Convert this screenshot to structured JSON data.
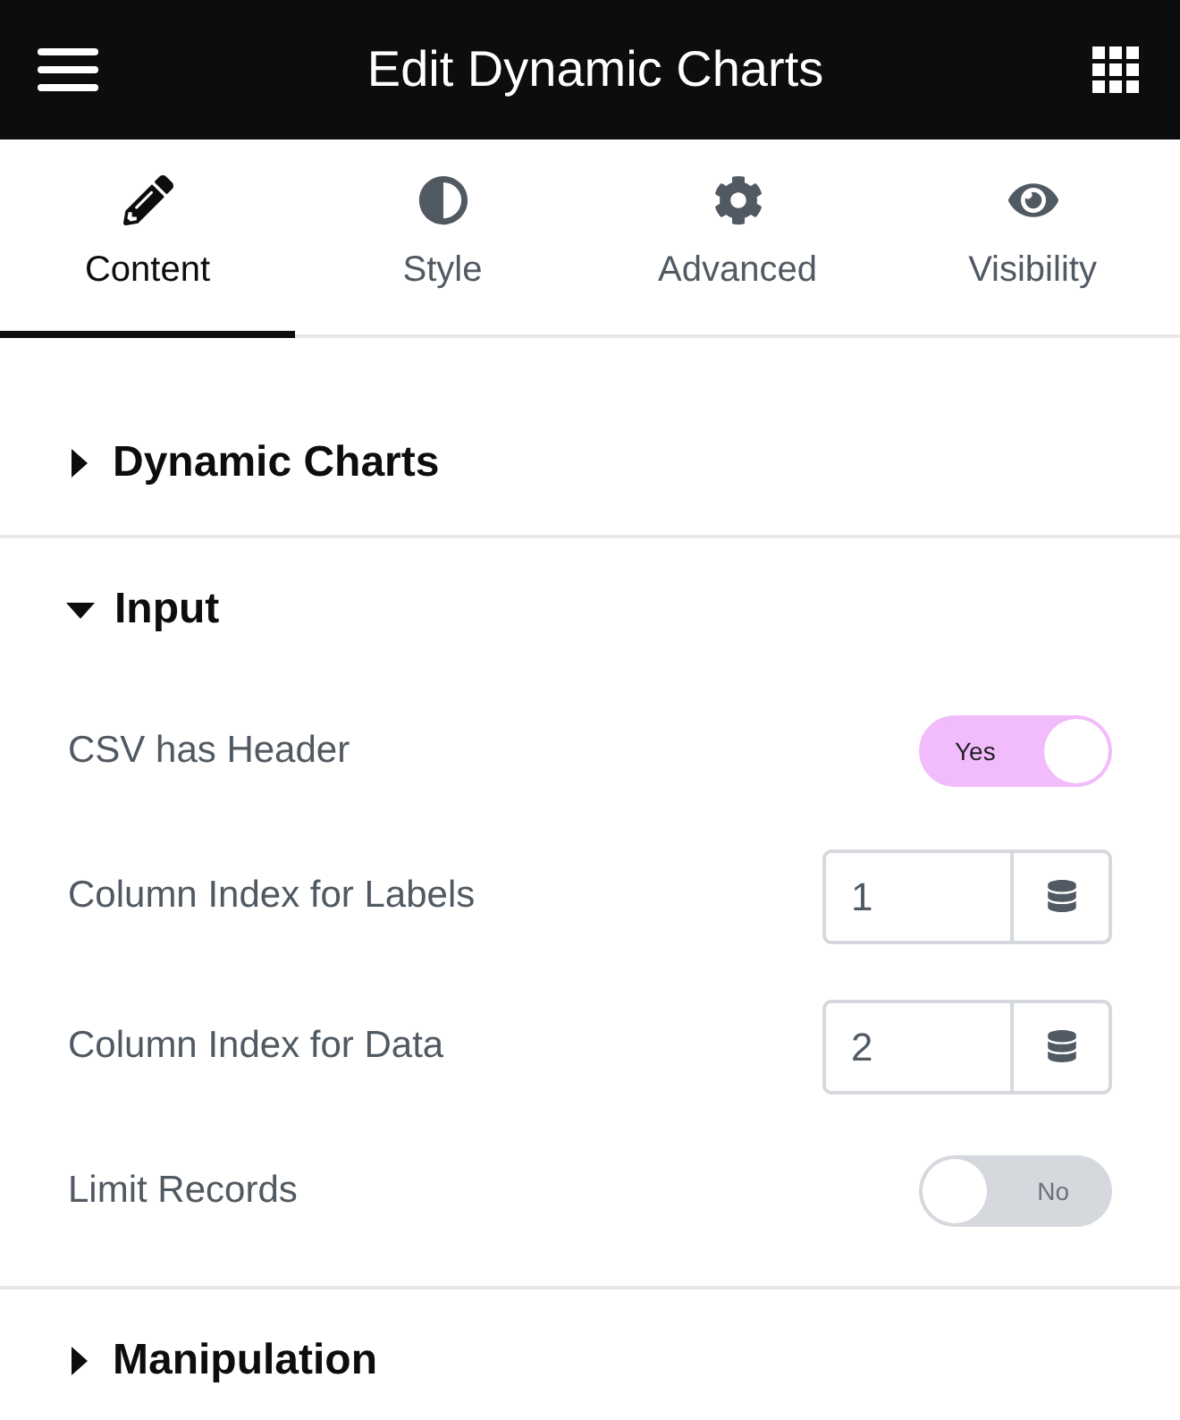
{
  "header": {
    "title": "Edit Dynamic Charts"
  },
  "tabs": [
    {
      "label": "Content",
      "selected": true
    },
    {
      "label": "Style",
      "selected": false
    },
    {
      "label": "Advanced",
      "selected": false
    },
    {
      "label": "Visibility",
      "selected": false
    }
  ],
  "sections": [
    {
      "title": "Dynamic Charts",
      "expanded": false
    },
    {
      "title": "Input",
      "expanded": true,
      "controls": [
        {
          "kind": "switch",
          "label": "CSV has Header",
          "on": true,
          "text": "Yes"
        },
        {
          "kind": "number",
          "label": "Column Index for Labels",
          "value": "1"
        },
        {
          "kind": "number",
          "label": "Column Index for Data",
          "value": "2"
        },
        {
          "kind": "switch",
          "label": "Limit Records",
          "on": false,
          "text": "No"
        }
      ]
    },
    {
      "title": "Manipulation",
      "expanded": false
    }
  ]
}
